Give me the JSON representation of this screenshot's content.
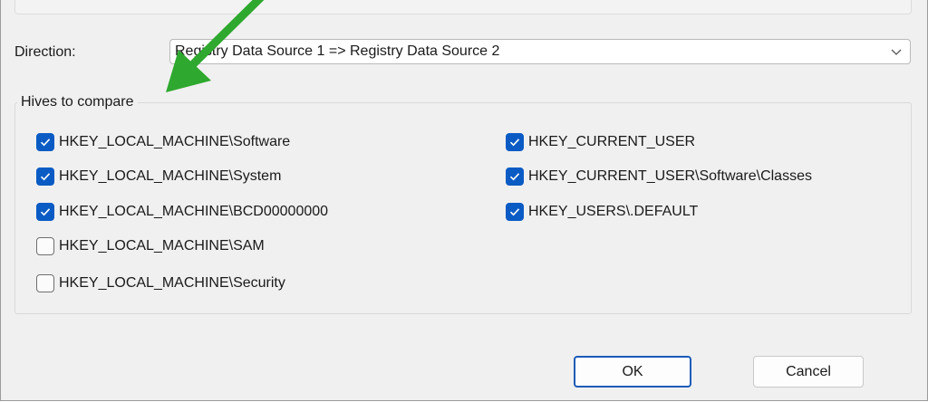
{
  "direction": {
    "label": "Direction:",
    "selected": "Registry Data Source 1 => Registry Data Source 2"
  },
  "hives": {
    "title": "Hives to compare",
    "left": [
      {
        "label": "HKEY_LOCAL_MACHINE\\Software",
        "checked": true
      },
      {
        "label": "HKEY_LOCAL_MACHINE\\System",
        "checked": true
      },
      {
        "label": "HKEY_LOCAL_MACHINE\\BCD00000000",
        "checked": true
      },
      {
        "label": "HKEY_LOCAL_MACHINE\\SAM",
        "checked": false
      },
      {
        "label": "HKEY_LOCAL_MACHINE\\Security",
        "checked": false
      }
    ],
    "right": [
      {
        "label": "HKEY_CURRENT_USER",
        "checked": true
      },
      {
        "label": "HKEY_CURRENT_USER\\Software\\Classes",
        "checked": true
      },
      {
        "label": "HKEY_USERS\\.DEFAULT",
        "checked": true
      }
    ]
  },
  "buttons": {
    "ok": "OK",
    "cancel": "Cancel"
  },
  "colors": {
    "accent": "#0a5bc4",
    "annotation_arrow": "#2ea82e"
  },
  "icons": {
    "dropdown": "chevron-down-icon",
    "check": "checkmark-icon",
    "annotation": "green-arrow-icon"
  }
}
